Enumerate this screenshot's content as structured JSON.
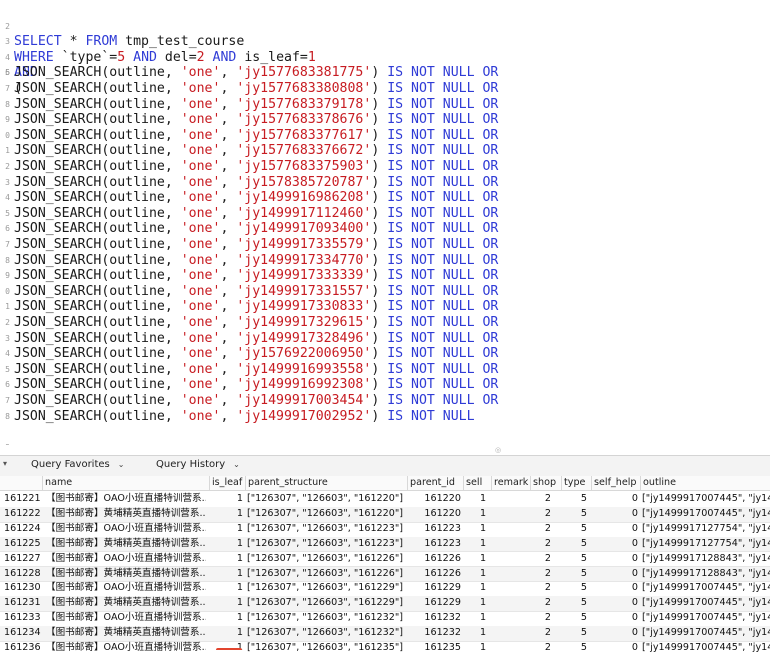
{
  "editor": {
    "line1": {
      "ln": "2",
      "select": "SELECT",
      "star": " * ",
      "from": "FROM",
      "table": " tmp_test_course"
    },
    "line2": {
      "ln": "3",
      "where": "WHERE",
      "a": " `type`=",
      "v1": "5",
      "and1": " AND",
      "b": " del=",
      "v2": "2",
      "and2": " AND",
      "c": " is_leaf=",
      "v3": "1"
    },
    "line3": {
      "ln": "4",
      "and": "AND"
    },
    "line4": {
      "ln": "5",
      "paren": "("
    },
    "search_lines": [
      {
        "ln": "6",
        "fn": "JSON_SEARCH(outline, ",
        "one": "'one'",
        "sep": ", ",
        "id": "'jy1577683381775'",
        "close": ") ",
        "tail": "IS NOT NULL OR"
      },
      {
        "ln": "7",
        "fn": "JSON_SEARCH(outline, ",
        "one": "'one'",
        "sep": ", ",
        "id": "'jy1577683380808'",
        "close": ") ",
        "tail": "IS NOT NULL OR"
      },
      {
        "ln": "8",
        "fn": "JSON_SEARCH(outline, ",
        "one": "'one'",
        "sep": ", ",
        "id": "'jy1577683379178'",
        "close": ") ",
        "tail": "IS NOT NULL OR"
      },
      {
        "ln": "9",
        "fn": "JSON_SEARCH(outline, ",
        "one": "'one'",
        "sep": ", ",
        "id": "'jy1577683378676'",
        "close": ") ",
        "tail": "IS NOT NULL OR"
      },
      {
        "ln": "0",
        "fn": "JSON_SEARCH(outline, ",
        "one": "'one'",
        "sep": ", ",
        "id": "'jy1577683377617'",
        "close": ") ",
        "tail": "IS NOT NULL OR"
      },
      {
        "ln": "1",
        "fn": "JSON_SEARCH(outline, ",
        "one": "'one'",
        "sep": ", ",
        "id": "'jy1577683376672'",
        "close": ") ",
        "tail": "IS NOT NULL OR"
      },
      {
        "ln": "2",
        "fn": "JSON_SEARCH(outline, ",
        "one": "'one'",
        "sep": ", ",
        "id": "'jy1577683375903'",
        "close": ") ",
        "tail": "IS NOT NULL OR"
      },
      {
        "ln": "3",
        "fn": "JSON_SEARCH(outline, ",
        "one": "'one'",
        "sep": ", ",
        "id": "'jy1578385720787'",
        "close": ") ",
        "tail": "IS NOT NULL OR"
      },
      {
        "ln": "4",
        "fn": "JSON_SEARCH(outline, ",
        "one": "'one'",
        "sep": ", ",
        "id": "'jy1499916986208'",
        "close": ") ",
        "tail": "IS NOT NULL OR"
      },
      {
        "ln": "5",
        "fn": "JSON_SEARCH(outline, ",
        "one": "'one'",
        "sep": ", ",
        "id": "'jy1499917112460'",
        "close": ") ",
        "tail": "IS NOT NULL OR"
      },
      {
        "ln": "6",
        "fn": "JSON_SEARCH(outline, ",
        "one": "'one'",
        "sep": ", ",
        "id": "'jy1499917093400'",
        "close": ") ",
        "tail": "IS NOT NULL OR"
      },
      {
        "ln": "7",
        "fn": "JSON_SEARCH(outline, ",
        "one": "'one'",
        "sep": ", ",
        "id": "'jy1499917335579'",
        "close": ") ",
        "tail": "IS NOT NULL OR"
      },
      {
        "ln": "8",
        "fn": "JSON_SEARCH(outline, ",
        "one": "'one'",
        "sep": ", ",
        "id": "'jy1499917334770'",
        "close": ") ",
        "tail": "IS NOT NULL OR"
      },
      {
        "ln": "9",
        "fn": "JSON_SEARCH(outline, ",
        "one": "'one'",
        "sep": ", ",
        "id": "'jy1499917333339'",
        "close": ") ",
        "tail": "IS NOT NULL OR"
      },
      {
        "ln": "0",
        "fn": "JSON_SEARCH(outline, ",
        "one": "'one'",
        "sep": ", ",
        "id": "'jy1499917331557'",
        "close": ") ",
        "tail": "IS NOT NULL OR"
      },
      {
        "ln": "1",
        "fn": "JSON_SEARCH(outline, ",
        "one": "'one'",
        "sep": ", ",
        "id": "'jy1499917330833'",
        "close": ") ",
        "tail": "IS NOT NULL OR"
      },
      {
        "ln": "2",
        "fn": "JSON_SEARCH(outline, ",
        "one": "'one'",
        "sep": ", ",
        "id": "'jy1499917329615'",
        "close": ") ",
        "tail": "IS NOT NULL OR"
      },
      {
        "ln": "3",
        "fn": "JSON_SEARCH(outline, ",
        "one": "'one'",
        "sep": ", ",
        "id": "'jy1499917328496'",
        "close": ") ",
        "tail": "IS NOT NULL OR"
      },
      {
        "ln": "4",
        "fn": "JSON_SEARCH(outline, ",
        "one": "'one'",
        "sep": ", ",
        "id": "'jy1576922006950'",
        "close": ") ",
        "tail": "IS NOT NULL OR"
      },
      {
        "ln": "5",
        "fn": "JSON_SEARCH(outline, ",
        "one": "'one'",
        "sep": ", ",
        "id": "'jy1499916993558'",
        "close": ") ",
        "tail": "IS NOT NULL OR"
      },
      {
        "ln": "6",
        "fn": "JSON_SEARCH(outline, ",
        "one": "'one'",
        "sep": ", ",
        "id": "'jy1499916992308'",
        "close": ") ",
        "tail": "IS NOT NULL OR"
      },
      {
        "ln": "7",
        "fn": "JSON_SEARCH(outline, ",
        "one": "'one'",
        "sep": ", ",
        "id": "'jy1499917003454'",
        "close": ") ",
        "tail": "IS NOT NULL OR"
      },
      {
        "ln": "8",
        "fn": "JSON_SEARCH(outline, ",
        "one": "'one'",
        "sep": ", ",
        "id": "'jy1499917002952'",
        "close": ") ",
        "tail": "IS NOT NULL"
      }
    ],
    "last": {
      "ln": "9",
      "paren": ")"
    }
  },
  "splitter": {
    "handle": "◎"
  },
  "query_bar": {
    "left_arrow": "▾",
    "favorites_label": "Query Favorites",
    "history_label": "Query History",
    "chevron": "⌄"
  },
  "grid": {
    "columns": [
      "name",
      "is_leaf",
      "parent_structure",
      "parent_id",
      "sell",
      "remark",
      "shop",
      "type",
      "self_help",
      "outline"
    ],
    "rows": [
      {
        "id": "161221",
        "name": "【图书邮寄】OAO小班直播特训营系...",
        "is_leaf": "1",
        "ps": "[\"126307\", \"126603\", \"161220\"]",
        "pid": "161220",
        "sell": "1",
        "remark": "",
        "shop": "2",
        "type": "5",
        "self": "0",
        "outline": "[\"jy1499917007445\", \"jy14"
      },
      {
        "id": "161222",
        "name": "【图书邮寄】黄埔精英直播特训营系...",
        "is_leaf": "1",
        "ps": "[\"126307\", \"126603\", \"161220\"]",
        "pid": "161220",
        "sell": "1",
        "remark": "",
        "shop": "2",
        "type": "5",
        "self": "0",
        "outline": "[\"jy1499917007445\", \"jy14"
      },
      {
        "id": "161224",
        "name": "【图书邮寄】OAO小班直播特训营系...",
        "is_leaf": "1",
        "ps": "[\"126307\", \"126603\", \"161223\"]",
        "pid": "161223",
        "sell": "1",
        "remark": "",
        "shop": "2",
        "type": "5",
        "self": "0",
        "outline": "[\"jy1499917127754\", \"jy14"
      },
      {
        "id": "161225",
        "name": "【图书邮寄】黄埔精英直播特训营系...",
        "is_leaf": "1",
        "ps": "[\"126307\", \"126603\", \"161223\"]",
        "pid": "161223",
        "sell": "1",
        "remark": "",
        "shop": "2",
        "type": "5",
        "self": "0",
        "outline": "[\"jy1499917127754\", \"jy14"
      },
      {
        "id": "161227",
        "name": "【图书邮寄】OAO小班直播特训营系...",
        "is_leaf": "1",
        "ps": "[\"126307\", \"126603\", \"161226\"]",
        "pid": "161226",
        "sell": "1",
        "remark": "",
        "shop": "2",
        "type": "5",
        "self": "0",
        "outline": "[\"jy1499917128843\", \"jy14"
      },
      {
        "id": "161228",
        "name": "【图书邮寄】黄埔精英直播特训营系...",
        "is_leaf": "1",
        "ps": "[\"126307\", \"126603\", \"161226\"]",
        "pid": "161226",
        "sell": "1",
        "remark": "",
        "shop": "2",
        "type": "5",
        "self": "0",
        "outline": "[\"jy1499917128843\", \"jy14"
      },
      {
        "id": "161230",
        "name": "【图书邮寄】OAO小班直播特训营系...",
        "is_leaf": "1",
        "ps": "[\"126307\", \"126603\", \"161229\"]",
        "pid": "161229",
        "sell": "1",
        "remark": "",
        "shop": "2",
        "type": "5",
        "self": "0",
        "outline": "[\"jy1499917007445\", \"jy14"
      },
      {
        "id": "161231",
        "name": "【图书邮寄】黄埔精英直播特训营系...",
        "is_leaf": "1",
        "ps": "[\"126307\", \"126603\", \"161229\"]",
        "pid": "161229",
        "sell": "1",
        "remark": "",
        "shop": "2",
        "type": "5",
        "self": "0",
        "outline": "[\"jy1499917007445\", \"jy14"
      },
      {
        "id": "161233",
        "name": "【图书邮寄】OAO小班直播特训营系...",
        "is_leaf": "1",
        "ps": "[\"126307\", \"126603\", \"161232\"]",
        "pid": "161232",
        "sell": "1",
        "remark": "",
        "shop": "2",
        "type": "5",
        "self": "0",
        "outline": "[\"jy1499917007445\", \"jy14"
      },
      {
        "id": "161234",
        "name": "【图书邮寄】黄埔精英直播特训营系...",
        "is_leaf": "1",
        "ps": "[\"126307\", \"126603\", \"161232\"]",
        "pid": "161232",
        "sell": "1",
        "remark": "",
        "shop": "2",
        "type": "5",
        "self": "0",
        "outline": "[\"jy1499917007445\", \"jy14"
      },
      {
        "id": "161236",
        "name": "【图书邮寄】OAO小班直播特训营系...",
        "is_leaf": "1",
        "ps": "[\"126307\", \"126603\", \"161235\"]",
        "pid": "161235",
        "sell": "1",
        "remark": "",
        "shop": "2",
        "type": "5",
        "self": "0",
        "outline": "[\"jy1499917007445\", \"jy14"
      }
    ]
  },
  "colors": {
    "keyword": "#2f3bd6",
    "string": "#c71c22",
    "annotation": "#e2452e"
  }
}
